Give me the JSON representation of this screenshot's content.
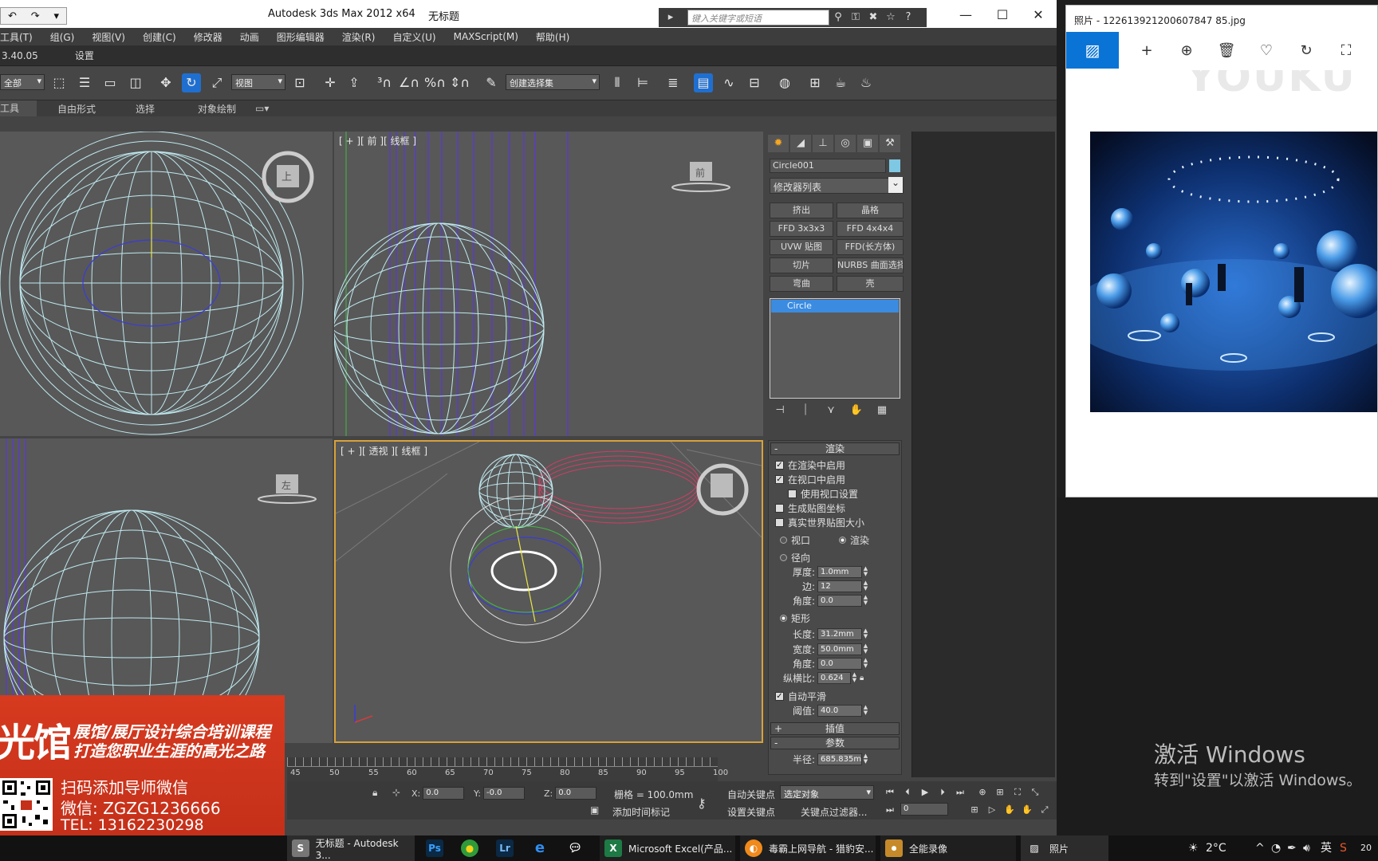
{
  "max": {
    "title_app": "Autodesk 3ds Max  2012 x64",
    "title_doc": "无标题",
    "search_placeholder": "键入关键字或短语",
    "menu": [
      "工具(T)",
      "组(G)",
      "视图(V)",
      "创建(C)",
      "修改器",
      "动画",
      "图形编辑器",
      "渲染(R)",
      "自定义(U)",
      "MAXScript(M)",
      "帮助(H)"
    ],
    "ribbon_row": [
      "3.40.05",
      "设置"
    ],
    "selection_filter": "全部",
    "ref_coord": "视图",
    "named_selection": "创建选择集",
    "ribbon_tabs": [
      "工具",
      "自由形式",
      "选择",
      "对象绘制"
    ],
    "viewports": {
      "front_label": "[ + ][ 前 ][ 线框 ]",
      "persp_label": "[ + ][ 透视 ][ 线框 ]",
      "viewcube_top": "上",
      "viewcube_front": "前",
      "viewcube_left": "左"
    },
    "cmd": {
      "object_name": "Circle001",
      "object_color": "#7ec8e3",
      "modifier_list": "修改器列表",
      "modifier_buttons": [
        "挤出",
        "晶格",
        "FFD 3x3x3",
        "FFD 4x4x4",
        "UVW 贴图",
        "FFD(长方体)",
        "切片",
        "NURBS 曲面选择",
        "弯曲",
        "壳"
      ],
      "stack_item": "Circle",
      "rendering_title": "渲染",
      "enable_in_renderer": "在渲染中启用",
      "enable_in_viewport": "在视口中启用",
      "use_viewport_settings": "使用视口设置",
      "gen_mapping": "生成贴图坐标",
      "real_world": "真实世界贴图大小",
      "radio_viewport": "视口",
      "radio_render": "渲染",
      "radial": "径向",
      "thickness_label": "厚度:",
      "thickness": "1.0mm",
      "sides_label": "边:",
      "sides": "12",
      "angle_label": "角度:",
      "angle": "0.0",
      "rectangular": "矩形",
      "length_label": "长度:",
      "length": "31.2mm",
      "width_label": "宽度:",
      "width": "50.0mm",
      "rect_angle_label": "角度:",
      "rect_angle": "0.0",
      "aspect_label": "纵横比:",
      "aspect": "0.624",
      "auto_smooth": "自动平滑",
      "threshold_label": "阈值:",
      "threshold": "40.0",
      "interp_title": "插值",
      "params_title": "参数",
      "radius_label": "半径:",
      "radius": "685.835m"
    },
    "timeline_nums": [
      "45",
      "50",
      "55",
      "60",
      "65",
      "70",
      "75",
      "80",
      "85",
      "90",
      "95",
      "100"
    ],
    "status": {
      "x_label": "X:",
      "x": "0.0",
      "y_label": "Y:",
      "y": "-0.0",
      "z_label": "Z:",
      "z": "0.0",
      "grid": "栅格 = 100.0mm",
      "add_time_tag": "添加时间标记",
      "auto_key": "自动关键点",
      "set_key": "设置关键点",
      "selected_object": "选定对象",
      "key_filters": "关键点过滤器...",
      "frame": "0"
    }
  },
  "promo": {
    "brand": "光馆",
    "tagline1": "展馆/展厅设计综合培训课程",
    "tagline2": "打造您职业生涯的高光之路",
    "line1": "扫码添加导师微信",
    "line2": "微信: ZGZG1236666",
    "line3": "TEL: 13162230298"
  },
  "photos": {
    "title": "照片 - 122613921200607847 85.jpg",
    "watermark": "YOUKU"
  },
  "desktop": {
    "activate_title": "激活 Windows",
    "activate_sub": "转到\"设置\"以激活 Windows。"
  },
  "taskbar": {
    "items": [
      {
        "label": "无标题 - Autodesk 3...",
        "icon": "3ds-max-icon"
      },
      {
        "label": "",
        "icon": "photoshop-icon"
      },
      {
        "label": "",
        "icon": "browser-360-icon"
      },
      {
        "label": "",
        "icon": "lightroom-icon"
      },
      {
        "label": "",
        "icon": "ie-icon"
      },
      {
        "label": "",
        "icon": "wechat-icon"
      },
      {
        "label": "Microsoft Excel(产品...",
        "icon": "excel-icon"
      },
      {
        "label": "毒霸上网导航 - 猎豹安...",
        "icon": "liebao-icon"
      },
      {
        "label": "全能录像",
        "icon": "recorder-icon"
      },
      {
        "label": "照片",
        "icon": "photos-icon"
      }
    ],
    "temperature": "2°C",
    "ime": "英",
    "clock": "20"
  }
}
